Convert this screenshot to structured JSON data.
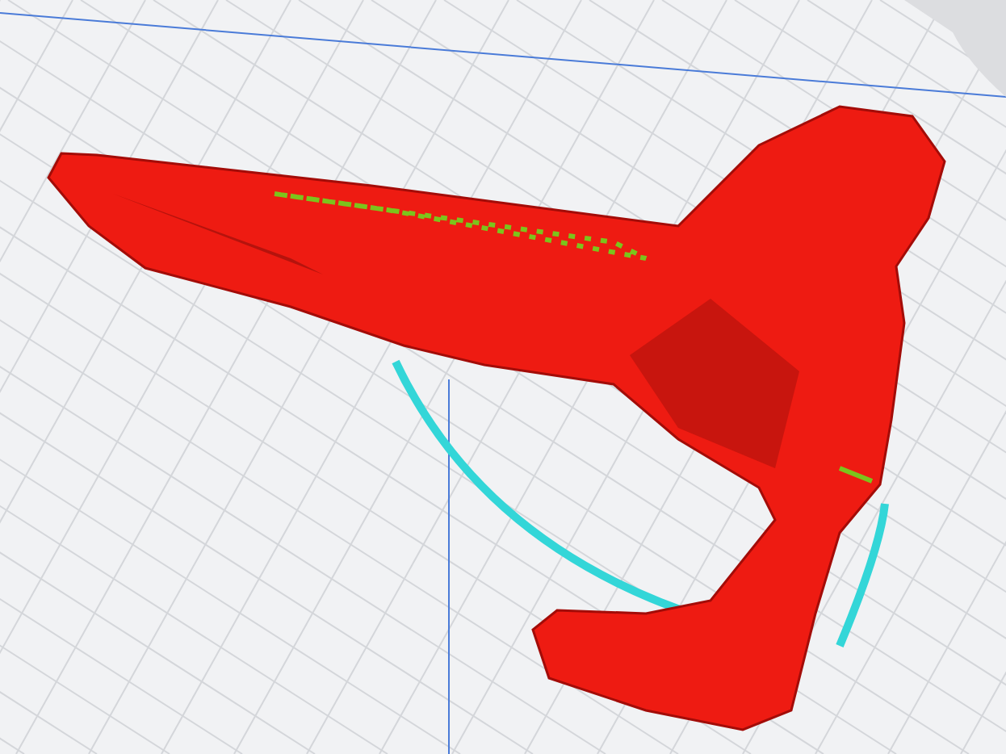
{
  "viewport": {
    "kind": "layer-preview"
  }
}
